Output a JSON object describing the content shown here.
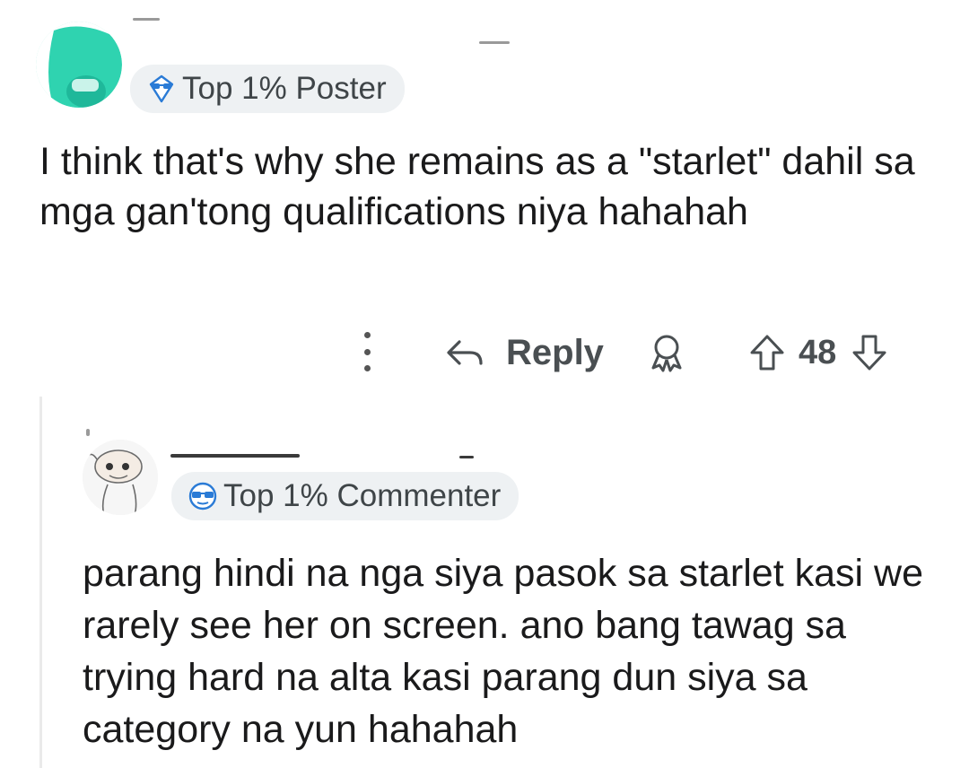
{
  "comment": {
    "flair": "Top 1% Poster",
    "flair_icon": "diamond-glasses-icon",
    "avatar_color": "#2fd3b0",
    "body": "I think that's why she remains as a \"starlet\" dahil sa mga gan'tong qualifications niya hahahah",
    "actions": {
      "more_icon": "kebab-menu-icon",
      "reply_label": "Reply",
      "award_icon": "award-icon",
      "score": "48"
    }
  },
  "reply": {
    "flair": "Top 1% Commenter",
    "flair_icon": "glasses-badge-icon",
    "body": "parang hindi na nga siya pasok sa starlet kasi we rarely see her on screen. ano bang tawag sa trying hard na alta kasi parang dun siya sa category na yun hahahah"
  },
  "colors": {
    "flair_bg": "#eef1f3",
    "flair_icon": "#2a7bd6",
    "action_text": "#4a4f52"
  }
}
